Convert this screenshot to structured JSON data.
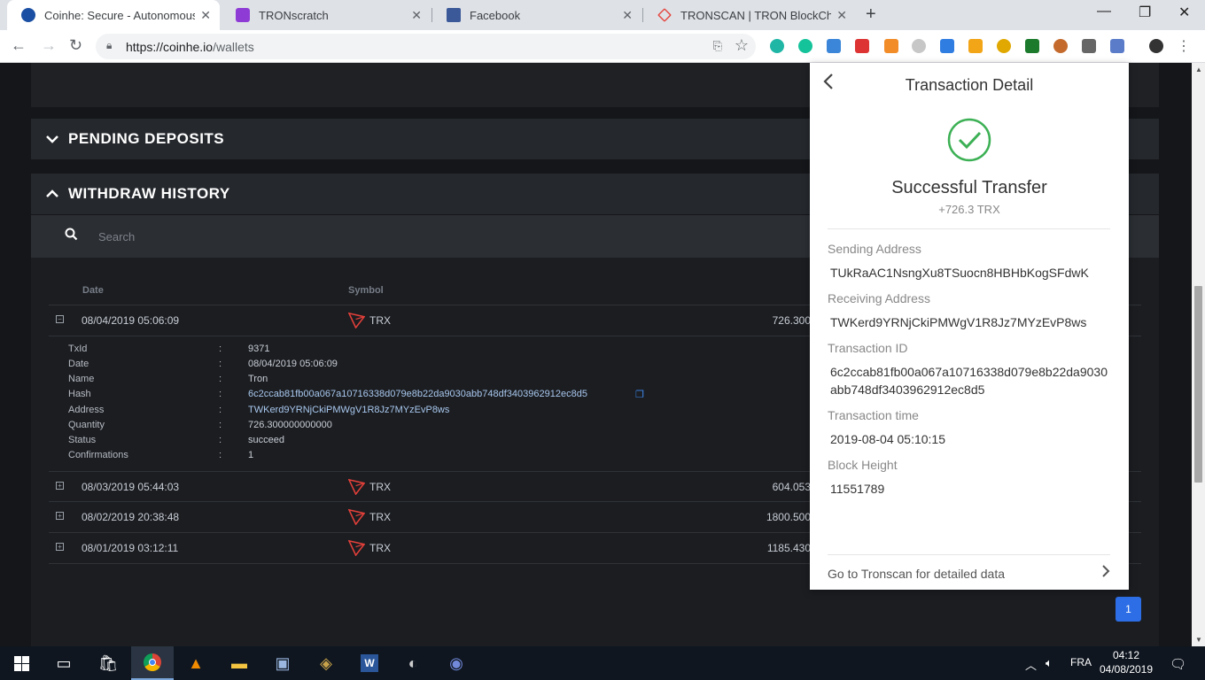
{
  "browser": {
    "tabs": [
      {
        "title": "Coinhe: Secure - Autonomous - T",
        "active": true,
        "icon": "coinhe-icon"
      },
      {
        "title": "TRONscratch",
        "active": false,
        "icon": "tronscratch-icon"
      },
      {
        "title": "Facebook",
        "active": false,
        "icon": "facebook-icon"
      },
      {
        "title": "TRONSCAN | TRON BlockChain E",
        "active": false,
        "icon": "tronscan-icon"
      }
    ],
    "url_host": "https://coinhe.io",
    "url_path": "/wallets"
  },
  "page": {
    "pending_deposits_label": "PENDING DEPOSITS",
    "withdraw_history_label": "WITHDRAW HISTORY",
    "search_placeholder": "Search",
    "columns": {
      "date": "Date",
      "symbol": "Symbol"
    },
    "rows": [
      {
        "date": "08/04/2019 05:06:09",
        "symbol": "TRX",
        "quantity": "726.300"
      },
      {
        "date": "08/03/2019 05:44:03",
        "symbol": "TRX",
        "quantity": "604.053"
      },
      {
        "date": "08/02/2019 20:38:48",
        "symbol": "TRX",
        "quantity": "1800.500"
      },
      {
        "date": "08/01/2019 03:12:11",
        "symbol": "TRX",
        "quantity": "1185.430"
      }
    ],
    "detail": [
      {
        "key": "TxId",
        "value": "9371"
      },
      {
        "key": "Date",
        "value": "08/04/2019 05:06:09"
      },
      {
        "key": "Name",
        "value": "Tron"
      },
      {
        "key": "Hash",
        "value": "6c2ccab81fb00a067a10716338d079e8b22da9030abb748df3403962912ec8d5"
      },
      {
        "key": "Address",
        "value": "TWKerd9YRNjCkiPMWgV1R8Jz7MYzEvP8ws"
      },
      {
        "key": "Quantity",
        "value": "726.300000000000"
      },
      {
        "key": "Status",
        "value": "succeed"
      },
      {
        "key": "Confirmations",
        "value": "1"
      }
    ],
    "detail_separator": ":",
    "pager": "1"
  },
  "popup": {
    "title": "Transaction Detail",
    "status": "Successful Transfer",
    "amount": "+726.3 TRX",
    "fields": [
      {
        "label": "Sending Address",
        "value": "TUkRaAC1NsngXu8TSuocn8HBHbKogSFdwK"
      },
      {
        "label": "Receiving Address",
        "value": "TWKerd9YRNjCkiPMWgV1R8Jz7MYzEvP8ws"
      },
      {
        "label": "Transaction ID",
        "value": "6c2ccab81fb00a067a10716338d079e8b22da9030abb748df3403962912ec8d5"
      },
      {
        "label": "Transaction time",
        "value": "2019-08-04 05:10:15"
      },
      {
        "label": "Block Height",
        "value": "11551789"
      }
    ],
    "footer_link": "Go to Tronscan for detailed data"
  },
  "taskbar": {
    "language": "FRA",
    "time": "04:12",
    "date": "04/08/2019"
  },
  "colors": {
    "accent_blue": "#2d6ee6",
    "success_green": "#3cb054",
    "tron_red": "#e5403a"
  }
}
